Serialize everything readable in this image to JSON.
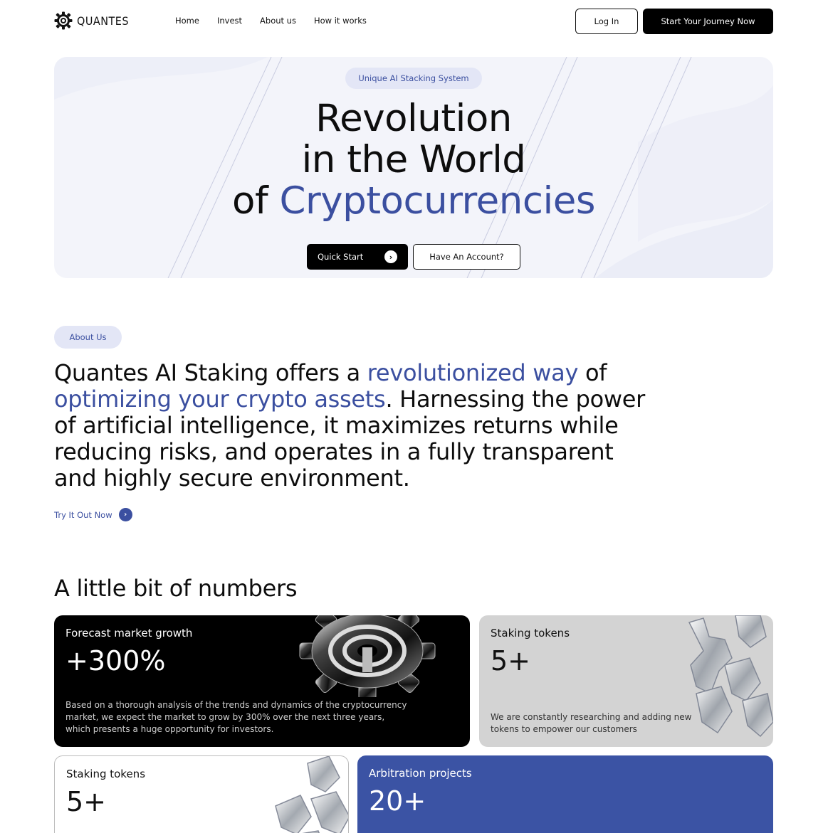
{
  "brand": {
    "name": "QUANTES",
    "icon": "gear-logo-icon"
  },
  "nav": {
    "links": [
      "Home",
      "Invest",
      "About us",
      "How it works"
    ]
  },
  "header": {
    "login_label": "Log In",
    "start_label": "Start Your Journey Now"
  },
  "hero": {
    "badge": "Unique AI Stacking System",
    "title_line1": "Revolution",
    "title_line2": "in the World",
    "title_line3_prefix": "of ",
    "title_line3_accent": "Cryptocurrencies",
    "quick_start_label": "Quick Start",
    "have_account_label": "Have An Account?"
  },
  "about": {
    "badge": "About Us",
    "part1": "Quantes AI Staking offers a ",
    "accent1": "revolutionized way",
    "part2": " of ",
    "accent2": "optimizing your crypto assets",
    "part3": ". Harnessing the power of artificial intelligence, it maximizes returns while reducing risks, and operates in a fully transparent and highly secure environment.",
    "try_label": "Try It Out Now"
  },
  "numbers": {
    "title": "A little bit of numbers",
    "cards": [
      {
        "label": "Forecast market growth",
        "value": "+300%",
        "desc": "Based on a thorough analysis of the trends and dynamics of the cryptocurrency market, we expect the market to grow by 300% over the next three years, which presents a huge opportunity for investors."
      },
      {
        "label": "Staking tokens",
        "value": "5+",
        "desc": "We are constantly researching and adding new tokens to empower our customers"
      },
      {
        "label": "Staking tokens",
        "value": "5+"
      },
      {
        "label": "Arbitration projects",
        "value": "20+"
      }
    ]
  },
  "colors": {
    "accent": "#3b4fa0",
    "hero_bg": "#f3f4fa",
    "card_blue": "#3b53a4"
  }
}
